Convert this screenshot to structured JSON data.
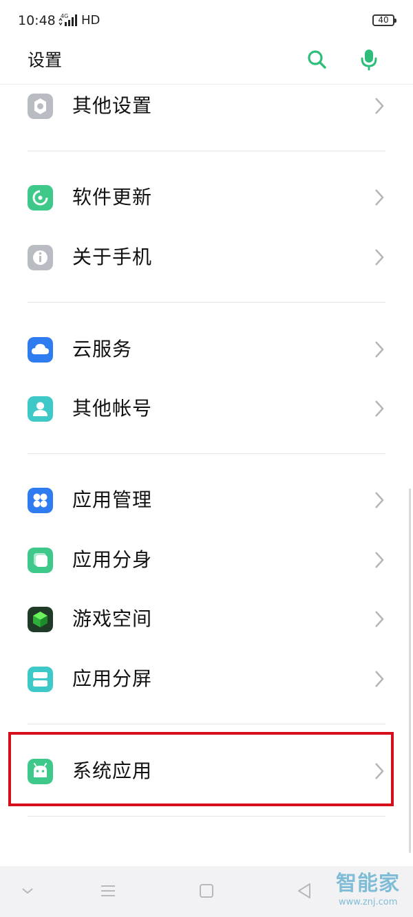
{
  "status_bar": {
    "time": "10:48",
    "network": "HD",
    "battery": "40"
  },
  "header": {
    "title": "设置",
    "search_icon": "search-icon",
    "mic_icon": "mic-icon",
    "accent_color": "#2ebd7b"
  },
  "items": [
    {
      "label": "其他设置",
      "icon": "gear-icon",
      "color": "#b9bcc2"
    },
    {
      "label": "软件更新",
      "icon": "update-icon",
      "color": "#3ec98a"
    },
    {
      "label": "关于手机",
      "icon": "info-icon",
      "color": "#b9bcc2"
    },
    {
      "label": "云服务",
      "icon": "cloud-icon",
      "color": "#2f7cf0"
    },
    {
      "label": "其他帐号",
      "icon": "person-icon",
      "color": "#3fc8c8"
    },
    {
      "label": "应用管理",
      "icon": "grid-icon",
      "color": "#2f7cf0"
    },
    {
      "label": "应用分身",
      "icon": "clone-icon",
      "color": "#3ec98a"
    },
    {
      "label": "游戏空间",
      "icon": "cube-icon",
      "color": "#1f3a26"
    },
    {
      "label": "应用分屏",
      "icon": "split-icon",
      "color": "#3fc8c8"
    },
    {
      "label": "系统应用",
      "icon": "android-icon",
      "color": "#3ec98a"
    }
  ],
  "highlight_color": "#d5101a",
  "watermark": {
    "text": "智能家",
    "url": "www.znj.com"
  }
}
